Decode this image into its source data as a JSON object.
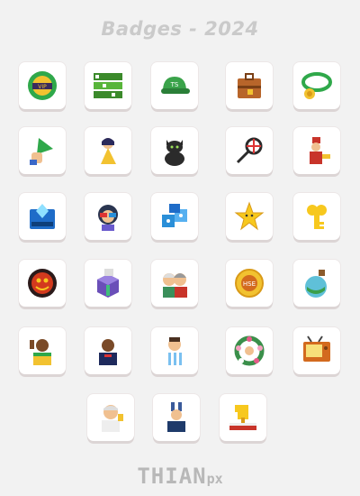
{
  "header": {
    "title": "Badges - 2024"
  },
  "badges": [
    {
      "icon": "vip-chip-icon"
    },
    {
      "icon": "green-graffiti-text-icon"
    },
    {
      "icon": "green-cap-icon"
    },
    {
      "icon": "suitcase-icon"
    },
    {
      "icon": "green-medal-ribbon-icon"
    },
    {
      "icon": "hand-holding-triangle-icon"
    },
    {
      "icon": "girl-yellow-dress-icon"
    },
    {
      "icon": "black-cat-icon"
    },
    {
      "icon": "key-crosshair-icon"
    },
    {
      "icon": "fez-musician-icon"
    },
    {
      "icon": "blue-gem-sign-icon"
    },
    {
      "icon": "girl-3d-glasses-icon"
    },
    {
      "icon": "blue-dice-blocks-icon"
    },
    {
      "icon": "gold-star-icon"
    },
    {
      "icon": "gold-key-icon"
    },
    {
      "icon": "red-emblem-icon"
    },
    {
      "icon": "purple-mech-crate-icon"
    },
    {
      "icon": "old-couple-icon"
    },
    {
      "icon": "hse-compass-icon"
    },
    {
      "icon": "potion-bottle-icon"
    },
    {
      "icon": "thumbs-up-man-icon"
    },
    {
      "icon": "man-dark-shirt-icon"
    },
    {
      "icon": "man-striped-jersey-icon"
    },
    {
      "icon": "flower-wreath-icon"
    },
    {
      "icon": "retro-tv-icon"
    },
    {
      "icon": "man-thumbs-up-icon"
    },
    {
      "icon": "bunny-ears-person-icon"
    },
    {
      "icon": "gold-trophy-book-icon"
    }
  ],
  "footer": {
    "brand_main": "THIAN",
    "brand_suffix": "px"
  }
}
